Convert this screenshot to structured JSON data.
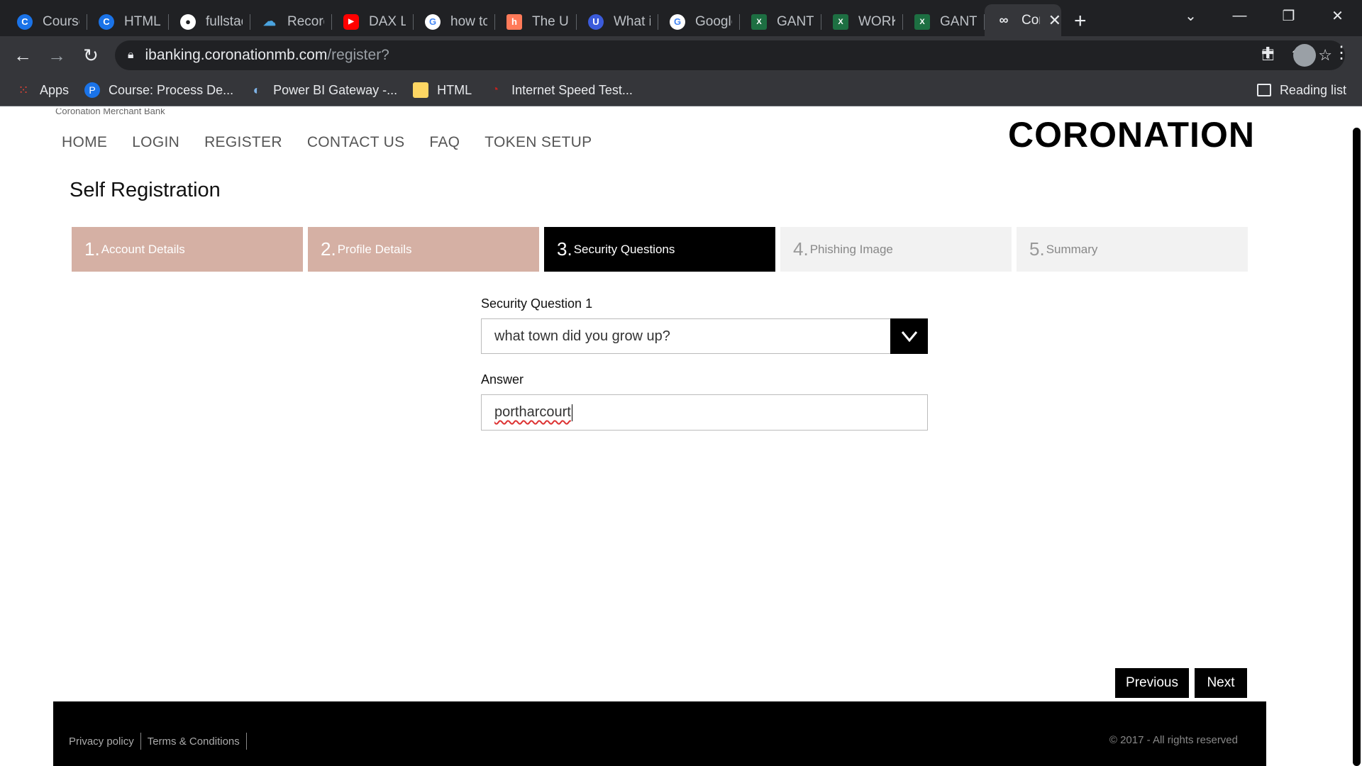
{
  "browser": {
    "tabs": [
      {
        "label": "Course",
        "icon": "c-icon",
        "color": "#1a73e8"
      },
      {
        "label": "HTML,",
        "icon": "c-icon",
        "color": "#1a73e8"
      },
      {
        "label": "fullstac",
        "icon": "github-icon",
        "color": "#202124"
      },
      {
        "label": "Record",
        "icon": "cloud-icon",
        "color": "#0078d4"
      },
      {
        "label": "DAX La",
        "icon": "youtube-icon",
        "color": "#ff0000"
      },
      {
        "label": "how to",
        "icon": "google-icon",
        "color": "#ffffff"
      },
      {
        "label": "The Ult",
        "icon": "hubspot-icon",
        "color": "#ff7a59"
      },
      {
        "label": "What i",
        "icon": "u-icon",
        "color": "#3b5bdb"
      },
      {
        "label": "Google",
        "icon": "google-icon",
        "color": "#ffffff"
      },
      {
        "label": "GANTT",
        "icon": "excel-icon",
        "color": "#1d6f42"
      },
      {
        "label": "WORKI",
        "icon": "excel-icon",
        "color": "#1d6f42"
      },
      {
        "label": "GANTT",
        "icon": "excel-icon",
        "color": "#1d6f42"
      }
    ],
    "active_tab": {
      "label": "Cor",
      "icon": "coronation-icon"
    },
    "url_host": "ibanking.coronationmb.com",
    "url_path": "/register?",
    "bookmarks": [
      {
        "label": "Apps",
        "icon": "apps-grid-icon"
      },
      {
        "label": "Course: Process De...",
        "icon": "p-icon"
      },
      {
        "label": "Power BI Gateway -...",
        "icon": "powerbi-icon"
      },
      {
        "label": "HTML",
        "icon": "folder-icon"
      },
      {
        "label": "Internet Speed Test...",
        "icon": "speedtest-icon"
      }
    ],
    "reading_list": "Reading list"
  },
  "site": {
    "bank_name": "Coronation Merchant Bank",
    "logo": "CORONATION",
    "nav": [
      "HOME",
      "LOGIN",
      "REGISTER",
      "CONTACT US",
      "FAQ",
      "TOKEN SETUP"
    ]
  },
  "registration": {
    "title": "Self Registration",
    "steps": [
      {
        "num": "1.",
        "label": "Account Details",
        "state": "done"
      },
      {
        "num": "2.",
        "label": "Profile Details",
        "state": "done"
      },
      {
        "num": "3.",
        "label": "Security Questions",
        "state": "active"
      },
      {
        "num": "4.",
        "label": "Phishing Image",
        "state": "todo"
      },
      {
        "num": "5.",
        "label": "Summary",
        "state": "todo"
      }
    ],
    "question_label": "Security Question 1",
    "question_value": "what town did you grow up?",
    "answer_label": "Answer",
    "answer_value": "portharcourt",
    "previous": "Previous",
    "next": "Next"
  },
  "footer": {
    "links": [
      "Privacy policy",
      "Terms & Conditions"
    ],
    "copyright": "© 2017 - All rights reserved"
  },
  "colors": {
    "step_done": "#d5b0a4",
    "step_active": "#000000",
    "step_todo": "#f2f2f2"
  }
}
